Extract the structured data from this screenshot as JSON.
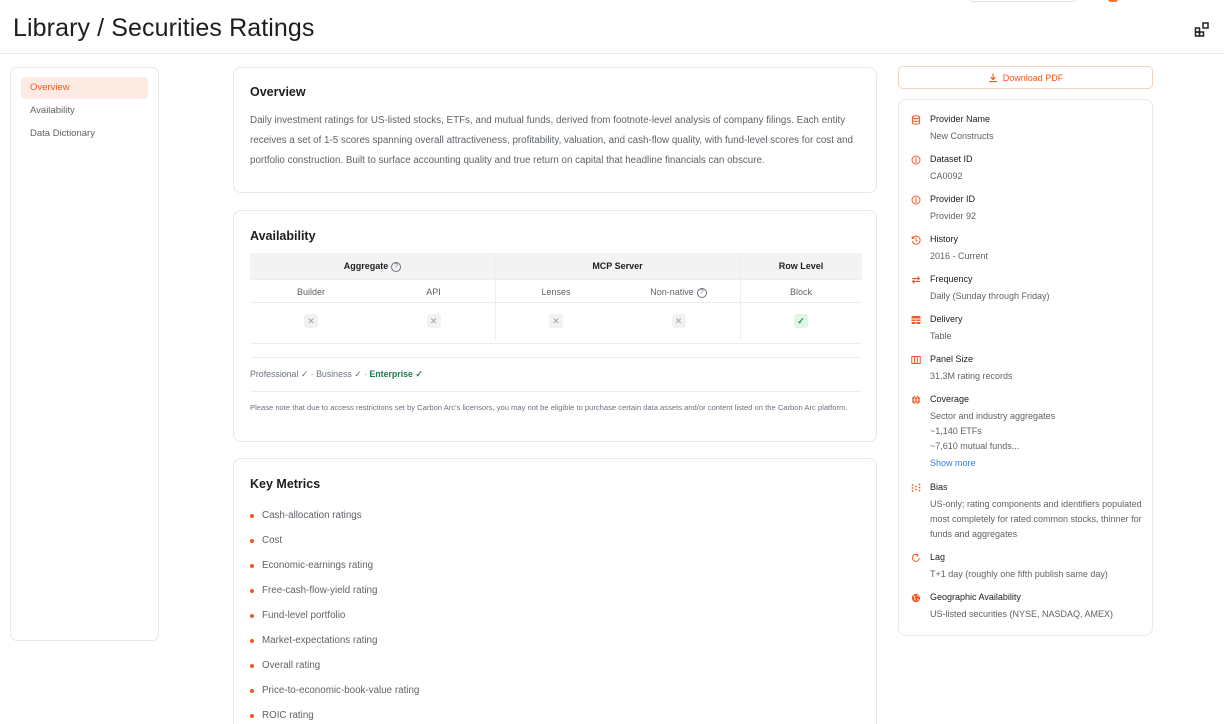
{
  "header": {
    "title": "Library / Securities Ratings"
  },
  "nav": {
    "items": [
      {
        "label": "Overview",
        "active": true
      },
      {
        "label": "Availability",
        "active": false
      },
      {
        "label": "Data Dictionary",
        "active": false
      }
    ]
  },
  "overview": {
    "title": "Overview",
    "text": "Daily investment ratings for US-listed stocks, ETFs, and mutual funds, derived from footnote-level analysis of company filings. Each entity receives a set of 1-5 scores spanning overall attractiveness, profitability, valuation, and cash-flow quality, with fund-level scores for cost and portfolio construction. Built to surface accounting quality and true return on capital that headline financials can obscure."
  },
  "availability": {
    "title": "Availability",
    "groups": [
      "Aggregate",
      "MCP Server",
      "Row Level"
    ],
    "columns": [
      "Builder",
      "API",
      "Lenses",
      "Non-native",
      "Block"
    ],
    "values": [
      "no",
      "no",
      "no",
      "no",
      "yes"
    ],
    "tiers": {
      "professional": "Professional ✓",
      "business": "Business ✓",
      "enterprise": "Enterprise ✓",
      "separator": " · "
    },
    "notice": "Please note that due to access restrictions set by Carbon Arc's licensors, you may not be eligible to purchase certain data assets and/or content listed on the Carbon Arc platform."
  },
  "key_metrics": {
    "title": "Key Metrics",
    "items": [
      "Cash-allocation ratings",
      "Cost",
      "Economic-earnings rating",
      "Free-cash-flow-yield rating",
      "Fund-level portfolio",
      "Market-expectations rating",
      "Overall rating",
      "Price-to-economic-book-value rating",
      "ROIC rating"
    ]
  },
  "sidebar": {
    "download_label": "Download PDF",
    "accent_color": "#f05a22",
    "items": [
      {
        "icon": "database-icon",
        "label": "Provider Name",
        "value": "New Constructs"
      },
      {
        "icon": "info-icon",
        "label": "Dataset ID",
        "value": "CA0092"
      },
      {
        "icon": "info-icon",
        "label": "Provider ID",
        "value": "Provider 92"
      },
      {
        "icon": "history-icon",
        "label": "History",
        "value": "2016 - Current"
      },
      {
        "icon": "repeat-icon",
        "label": "Frequency",
        "value": "Daily (Sunday through Friday)"
      },
      {
        "icon": "table-icon",
        "label": "Delivery",
        "value": "Table"
      },
      {
        "icon": "columns-icon",
        "label": "Panel Size",
        "value": "31.3M rating records"
      },
      {
        "icon": "globe-icon",
        "label": "Coverage",
        "value_lines": [
          "Sector and industry aggregates",
          "~1,140 ETFs",
          "~7,610 mutual funds..."
        ],
        "link": "Show more"
      },
      {
        "icon": "scatter-icon",
        "label": "Bias",
        "value": "US-only; rating components and identifiers populated most completely for rated common stocks, thinner for funds and aggregates"
      },
      {
        "icon": "refresh-icon",
        "label": "Lag",
        "value": "T+1 day (roughly one fifth publish same day)"
      },
      {
        "icon": "world-icon",
        "label": "Geographic Availability",
        "value": "US-listed securities (NYSE, NASDAQ, AMEX)"
      }
    ]
  }
}
